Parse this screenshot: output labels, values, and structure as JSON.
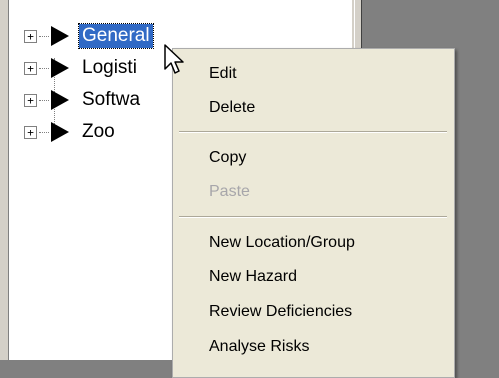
{
  "tree": {
    "nodes": [
      {
        "expander": "+",
        "label": "General",
        "selected": true
      },
      {
        "expander": "+",
        "label": "Logisti",
        "selected": false
      },
      {
        "expander": "+",
        "label": "Softwa",
        "selected": false
      },
      {
        "expander": "+",
        "label": "Zoo",
        "selected": false
      }
    ]
  },
  "context_menu": {
    "items": [
      {
        "label": "Edit",
        "enabled": true
      },
      {
        "label": "Delete",
        "enabled": true
      },
      {
        "label": "Copy",
        "enabled": true
      },
      {
        "label": "Paste",
        "enabled": false
      },
      {
        "label": "New Location/Group",
        "enabled": true
      },
      {
        "label": "New Hazard",
        "enabled": true
      },
      {
        "label": "Review Deficiencies",
        "enabled": true
      },
      {
        "label": "Analyse Risks",
        "enabled": true
      }
    ]
  },
  "colors": {
    "selection": "#316ac5",
    "disabled_text": "#a7a6aa",
    "menu_bg": "#ece9d8"
  }
}
